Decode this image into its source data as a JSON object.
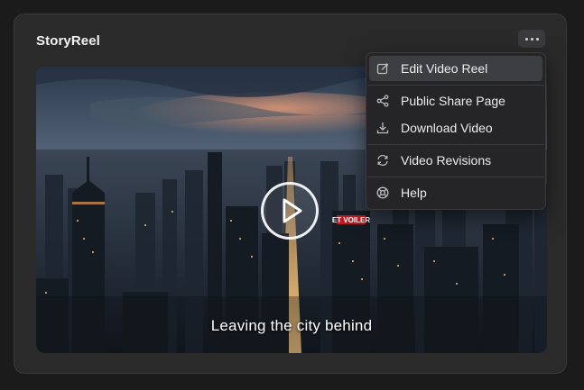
{
  "card": {
    "title": "StoryReel"
  },
  "video": {
    "caption": "Leaving the city behind",
    "billboard_text": "ET VOILER"
  },
  "menu": {
    "items": [
      {
        "label": "Edit Video Reel",
        "icon": "edit-icon"
      },
      {
        "label": "Public Share Page",
        "icon": "share-icon"
      },
      {
        "label": "Download Video",
        "icon": "download-icon"
      },
      {
        "label": "Video Revisions",
        "icon": "revisions-icon"
      },
      {
        "label": "Help",
        "icon": "help-icon"
      }
    ]
  },
  "colors": {
    "background": "#1b1b1c",
    "card": "#2a2a2b",
    "menu": "#252527",
    "menu_active": "#3d3e41",
    "text": "#ececec"
  }
}
